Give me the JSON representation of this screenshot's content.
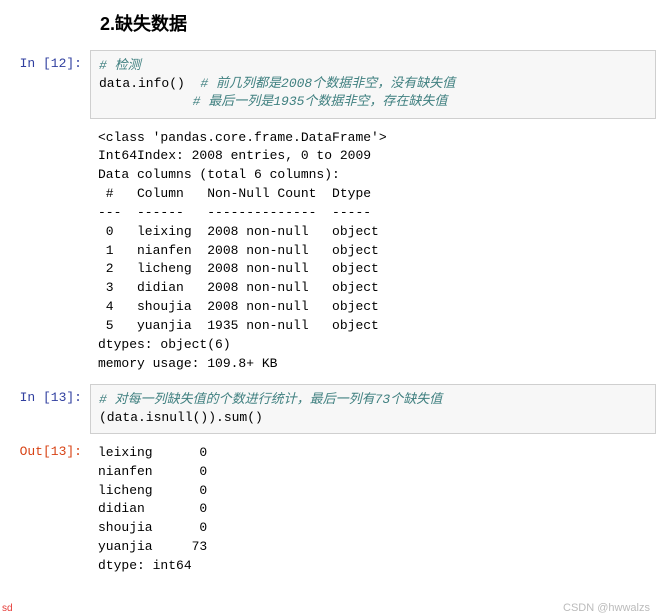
{
  "heading": "2.缺失数据",
  "cells": {
    "in12": {
      "prompt": "In  [12]:",
      "comment1": "# 检测",
      "call": "data.info()",
      "comment2": "  # 前几列都是2008个数据非空，没有缺失值",
      "comment3": "            # 最后一列是1935个数据非空，存在缺失值"
    },
    "out12_text": "<class 'pandas.core.frame.DataFrame'>\nInt64Index: 2008 entries, 0 to 2009\nData columns (total 6 columns):\n #   Column   Non-Null Count  Dtype\n---  ------   --------------  -----\n 0   leixing  2008 non-null   object\n 1   nianfen  2008 non-null   object\n 2   licheng  2008 non-null   object\n 3   didian   2008 non-null   object\n 4   shoujia  2008 non-null   object\n 5   yuanjia  1935 non-null   object\ndtypes: object(6)\nmemory usage: 109.8+ KB",
    "in13": {
      "prompt": "In  [13]:",
      "comment": "# 对每一列缺失值的个数进行统计，最后一列有73个缺失值",
      "code": "(data.isnull()).sum()"
    },
    "out13": {
      "prompt": "Out[13]:",
      "text": "leixing      0\nnianfen      0\nlicheng      0\ndidian       0\nshoujia      0\nyuanjia     73\ndtype: int64"
    }
  },
  "watermark": "CSDN @hwwalzs",
  "tiny": "sd",
  "chart_data": {
    "type": "table",
    "title": "data.info() columns",
    "columns": [
      "#",
      "Column",
      "Non-Null Count",
      "Dtype"
    ],
    "rows": [
      [
        0,
        "leixing",
        "2008 non-null",
        "object"
      ],
      [
        1,
        "nianfen",
        "2008 non-null",
        "object"
      ],
      [
        2,
        "licheng",
        "2008 non-null",
        "object"
      ],
      [
        3,
        "didian",
        "2008 non-null",
        "object"
      ],
      [
        4,
        "shoujia",
        "2008 non-null",
        "object"
      ],
      [
        5,
        "yuanjia",
        "1935 non-null",
        "object"
      ]
    ],
    "isnull_sum": {
      "leixing": 0,
      "nianfen": 0,
      "licheng": 0,
      "didian": 0,
      "shoujia": 0,
      "yuanjia": 73
    }
  }
}
